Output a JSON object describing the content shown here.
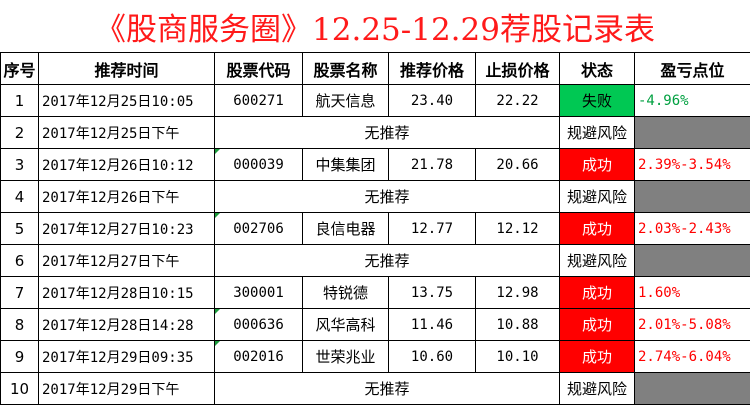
{
  "title": "《股商服务圈》12.25-12.29荐股记录表",
  "headers": [
    "序号",
    "推荐时间",
    "股票代码",
    "股票名称",
    "推荐价格",
    "止损价格",
    "状态",
    "盈亏点位"
  ],
  "rows": [
    {
      "no": "1",
      "time": "2017年12月25日10:05",
      "code": "600271",
      "name": "航天信息",
      "price": "23.40",
      "stop": "22.22",
      "status": "失败",
      "pl": "-4.96%"
    },
    {
      "no": "2",
      "time": "2017年12月25日下午",
      "none": "无推荐",
      "status": "规避风险",
      "pl": ""
    },
    {
      "no": "3",
      "time": "2017年12月26日10:12",
      "code": "000039",
      "name": "中集集团",
      "price": "21.78",
      "stop": "20.66",
      "status": "成功",
      "pl": "2.39%-3.54%"
    },
    {
      "no": "4",
      "time": "2017年12月26日下午",
      "none": "无推荐",
      "status": "规避风险",
      "pl": ""
    },
    {
      "no": "5",
      "time": "2017年12月27日10:23",
      "code": "002706",
      "name": "良信电器",
      "price": "12.77",
      "stop": "12.12",
      "status": "成功",
      "pl": "2.03%-2.43%"
    },
    {
      "no": "6",
      "time": "2017年12月27日下午",
      "none": "无推荐",
      "status": "规避风险",
      "pl": ""
    },
    {
      "no": "7",
      "time": "2017年12月28日10:15",
      "code": "300001",
      "name": "特锐德",
      "price": "13.75",
      "stop": "12.98",
      "status": "成功",
      "pl": "1.60%"
    },
    {
      "no": "8",
      "time": "2017年12月28日14:28",
      "code": "000636",
      "name": "风华高科",
      "price": "11.46",
      "stop": "10.88",
      "status": "成功",
      "pl": "2.01%-5.08%"
    },
    {
      "no": "9",
      "time": "2017年12月29日09:35",
      "code": "002016",
      "name": "世荣兆业",
      "price": "10.60",
      "stop": "10.10",
      "status": "成功",
      "pl": "2.74%-6.04%"
    },
    {
      "no": "10",
      "time": "2017年12月29日下午",
      "none": "无推荐",
      "status": "规避风险",
      "pl": ""
    }
  ],
  "colors": {
    "title": "#ff1a1a",
    "success": "#ff0000",
    "fail": "#00c853",
    "neutral": "#808080"
  }
}
